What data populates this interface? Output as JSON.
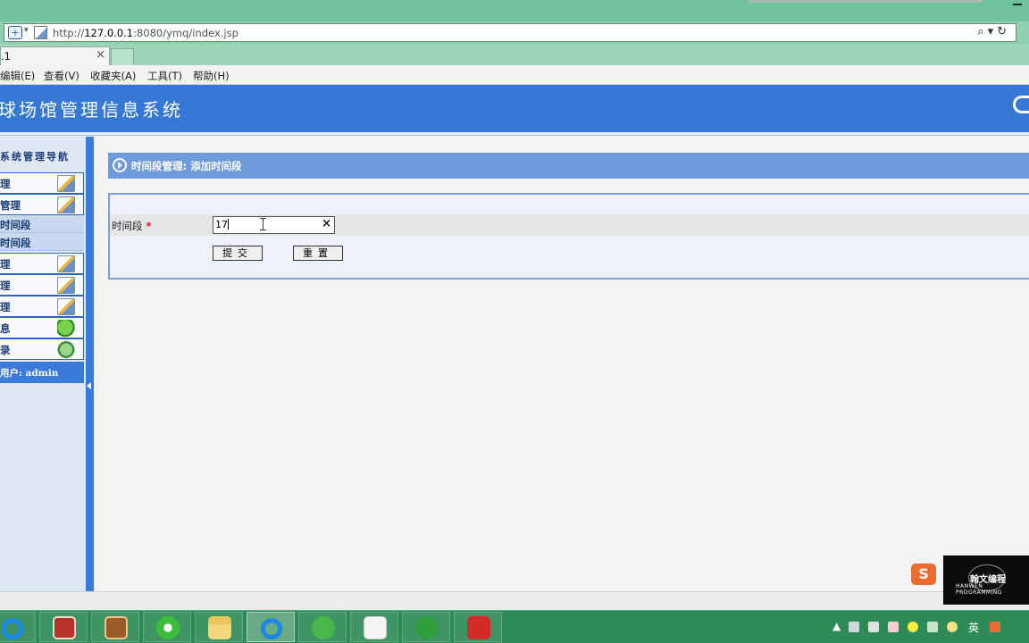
{
  "browser": {
    "url_prefix": "http://",
    "url_host": "127.0.0.1",
    "url_rest": ":8080/ymq/index.jsp",
    "tab_title": ".1",
    "tab_close": "×",
    "menu": [
      "编辑(E)",
      "查看(V)",
      "收藏夹(A)",
      "工具(T)",
      "帮助(H)"
    ]
  },
  "app": {
    "title": "球场馆管理信息系统"
  },
  "sidebar": {
    "heading": "系统管理导航",
    "items": [
      {
        "label": "理",
        "icon": "edit-icon"
      },
      {
        "label": "管理",
        "icon": "edit-icon"
      }
    ],
    "subitems": [
      "时间段",
      "时间段"
    ],
    "items2": [
      {
        "label": "理",
        "icon": "edit-icon"
      },
      {
        "label": "理",
        "icon": "edit-icon"
      },
      {
        "label": "理",
        "icon": "edit-icon"
      },
      {
        "label": "息",
        "icon": "arrow-icon"
      },
      {
        "label": "录",
        "icon": "exit-icon"
      }
    ],
    "user_label": "用户: admin"
  },
  "content": {
    "breadcrumb": "时间段管理: 添加时间段",
    "form": {
      "field_label": "时间段",
      "required_mark": "*",
      "field_value": "17",
      "clear_symbol": "×",
      "submit_label": "提交",
      "reset_label": "重置"
    }
  },
  "overlay": {
    "badge": "S",
    "watermark_title": "翰文编程",
    "watermark_sub": "HANWEN PROGRAMMING"
  },
  "taskbar": {
    "apps": [
      "ie-icon",
      "book-red-icon",
      "book-brown-icon",
      "browser-green-icon",
      "folder-icon",
      "ie-icon",
      "green-circle-icon",
      "java-icon",
      "paw-icon",
      "cow-icon"
    ],
    "tray_lang": "英"
  }
}
